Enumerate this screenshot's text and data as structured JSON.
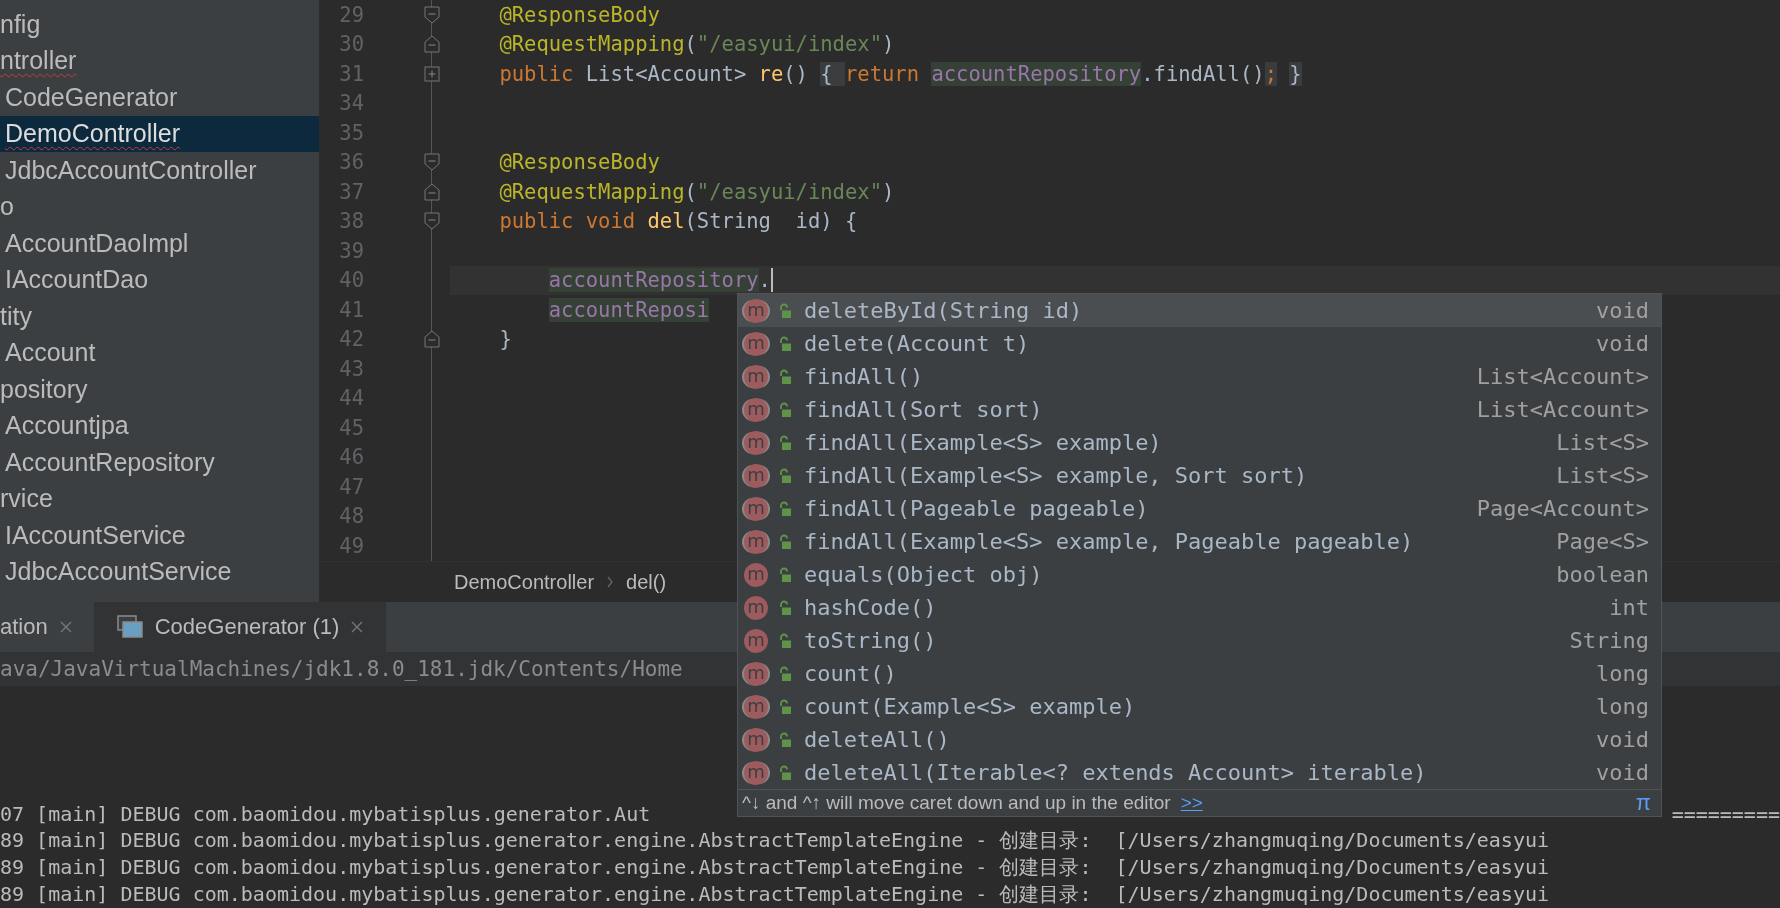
{
  "project_tree": {
    "items": [
      {
        "label": "nfig",
        "selected": false,
        "error": false
      },
      {
        "label": "ntroller",
        "selected": false,
        "error": true,
        "children": [
          {
            "label": "CodeGenerator",
            "selected": false,
            "error": false
          },
          {
            "label": "DemoController",
            "selected": true,
            "error": true
          },
          {
            "label": "JdbcAccountController",
            "selected": false,
            "error": false
          }
        ]
      },
      {
        "label": "o",
        "selected": false,
        "error": false,
        "children": [
          {
            "label": "AccountDaoImpl",
            "selected": false,
            "error": false
          },
          {
            "label": "IAccountDao",
            "selected": false,
            "error": false
          }
        ]
      },
      {
        "label": "tity",
        "selected": false,
        "error": false,
        "children": [
          {
            "label": "Account",
            "selected": false,
            "error": false
          }
        ]
      },
      {
        "label": "pository",
        "selected": false,
        "error": false,
        "children": [
          {
            "label": "Accountjpa",
            "selected": false,
            "error": false
          },
          {
            "label": "AccountRepository",
            "selected": false,
            "error": false
          }
        ]
      },
      {
        "label": "rvice",
        "selected": false,
        "error": false,
        "children": [
          {
            "label": "IAccountService",
            "selected": false,
            "error": false
          },
          {
            "label": "JdbcAccountService",
            "selected": false,
            "error": false
          }
        ]
      }
    ]
  },
  "editor": {
    "lines": [
      {
        "number": "29",
        "current": false,
        "fold_start": true,
        "tokens": [
          {
            "text": "    @ResponseBody",
            "kind": "annotation"
          }
        ]
      },
      {
        "number": "30",
        "current": false,
        "fold_end": true,
        "tokens": [
          {
            "text": "    @RequestMapping",
            "kind": "annotation"
          },
          {
            "text": "(",
            "kind": "plain"
          },
          {
            "text": "\"/easyui/index\"",
            "kind": "string"
          },
          {
            "text": ")",
            "kind": "plain"
          }
        ]
      },
      {
        "number": "31",
        "current": false,
        "collapsed": true,
        "tokens": [
          {
            "text": "    public",
            "kind": "keyword"
          },
          {
            "text": " List<Account> ",
            "kind": "plain"
          },
          {
            "text": "re",
            "kind": "method"
          },
          {
            "text": "()",
            "kind": "plain"
          },
          {
            "text": " { ",
            "kind": "plain",
            "folded": true
          },
          {
            "text": "return ",
            "kind": "keyword"
          },
          {
            "text": "accountRepository",
            "kind": "field",
            "usage": true
          },
          {
            "text": ".findAll()",
            "kind": "plain"
          },
          {
            "text": ";",
            "kind": "keyword",
            "folded": true
          },
          {
            "text": " }",
            "kind": "plain",
            "folded": true
          }
        ]
      },
      {
        "number": "34",
        "current": false
      },
      {
        "number": "35",
        "current": false
      },
      {
        "number": "36",
        "current": false,
        "fold_start": true,
        "tokens": [
          {
            "text": "    @ResponseBody",
            "kind": "annotation"
          }
        ]
      },
      {
        "number": "37",
        "current": false,
        "fold_end": true,
        "tokens": [
          {
            "text": "    @RequestMapping",
            "kind": "annotation"
          },
          {
            "text": "(",
            "kind": "plain"
          },
          {
            "text": "\"/easyui/index\"",
            "kind": "string"
          },
          {
            "text": ")",
            "kind": "plain"
          }
        ]
      },
      {
        "number": "38",
        "current": false,
        "fold_start": true,
        "tokens": [
          {
            "text": "    public void ",
            "kind": "keyword"
          },
          {
            "text": "del",
            "kind": "method"
          },
          {
            "text": "(String  id) {",
            "kind": "plain"
          }
        ]
      },
      {
        "number": "39",
        "current": false
      },
      {
        "number": "40",
        "current": true,
        "tokens": [
          {
            "text": "        accountRepository",
            "kind": "field",
            "usage": true
          },
          {
            "text": ".",
            "kind": "plain"
          }
        ]
      },
      {
        "number": "41",
        "current": false,
        "tokens": [
          {
            "text": "        accountReposi",
            "kind": "field",
            "usage": true
          }
        ]
      },
      {
        "number": "42",
        "current": false,
        "fold_end": true,
        "tokens": [
          {
            "text": "    }",
            "kind": "plain"
          }
        ]
      },
      {
        "number": "43",
        "current": false
      },
      {
        "number": "44",
        "current": false
      },
      {
        "number": "45",
        "current": false
      },
      {
        "number": "46",
        "current": false
      },
      {
        "number": "47",
        "current": false
      },
      {
        "number": "48",
        "current": false
      },
      {
        "number": "49",
        "current": false
      }
    ],
    "breadcrumbs": [
      "DemoController",
      "del()"
    ]
  },
  "completion": {
    "items": [
      {
        "icon": "m",
        "bracketed": true,
        "selected": true,
        "signature": "deleteById(String id)",
        "type": "void"
      },
      {
        "icon": "m",
        "bracketed": true,
        "selected": false,
        "signature": "delete(Account t)",
        "type": "void"
      },
      {
        "icon": "m",
        "bracketed": true,
        "selected": false,
        "signature": "findAll()",
        "type": "List<Account>"
      },
      {
        "icon": "m",
        "bracketed": true,
        "selected": false,
        "signature": "findAll(Sort sort)",
        "type": "List<Account>"
      },
      {
        "icon": "m",
        "bracketed": true,
        "selected": false,
        "signature": "findAll(Example<S> example)",
        "type": "List<S>"
      },
      {
        "icon": "m",
        "bracketed": true,
        "selected": false,
        "signature": "findAll(Example<S> example, Sort sort)",
        "type": "List<S>"
      },
      {
        "icon": "m",
        "bracketed": true,
        "selected": false,
        "signature": "findAll(Pageable pageable)",
        "type": "Page<Account>"
      },
      {
        "icon": "m",
        "bracketed": true,
        "selected": false,
        "signature": "findAll(Example<S> example, Pageable pageable)",
        "type": "Page<S>"
      },
      {
        "icon": "m",
        "bracketed": false,
        "selected": false,
        "signature": "equals(Object obj)",
        "type": "boolean"
      },
      {
        "icon": "m",
        "bracketed": false,
        "selected": false,
        "signature": "hashCode()",
        "type": "int"
      },
      {
        "icon": "m",
        "bracketed": false,
        "selected": false,
        "signature": "toString()",
        "type": "String"
      },
      {
        "icon": "m",
        "bracketed": true,
        "selected": false,
        "signature": "count()",
        "type": "long"
      },
      {
        "icon": "m",
        "bracketed": true,
        "selected": false,
        "signature": "count(Example<S> example)",
        "type": "long"
      },
      {
        "icon": "m",
        "bracketed": true,
        "selected": false,
        "signature": "deleteAll()",
        "type": "void"
      },
      {
        "icon": "m",
        "bracketed": true,
        "selected": false,
        "signature": "deleteAll(Iterable<? extends Account> iterable)",
        "type": "void"
      }
    ],
    "hint": "^↓ and ^↑ will move caret down and up in the editor",
    "hint_link": ">>",
    "pi": "π"
  },
  "run_panel": {
    "tabs": [
      {
        "label": "ation",
        "selected": false
      },
      {
        "label": "CodeGenerator (1)",
        "selected": true
      }
    ],
    "command_line": "ava/JavaVirtualMachines/jdk1.8.0_181.jdk/Contents/Home",
    "console_lines": [
      {
        "left": "07 [main] DEBUG com.baomidou.mybatisplus.generator.Aut",
        "right": "========="
      },
      {
        "left": "89 [main] DEBUG com.baomidou.mybatisplus.generator.engine.AbstractTemplateEngine - 创建目录:  [/Users/zhangmuqing/Documents/easyui"
      },
      {
        "left": "89 [main] DEBUG com.baomidou.mybatisplus.generator.engine.AbstractTemplateEngine - 创建目录:  [/Users/zhangmuqing/Documents/easyui"
      },
      {
        "left": "89 [main] DEBUG com.baomidou.mybatisplus.generator.engine.AbstractTemplateEngine - 创建目录:  [/Users/zhangmuqing/Documents/easyui"
      }
    ]
  }
}
